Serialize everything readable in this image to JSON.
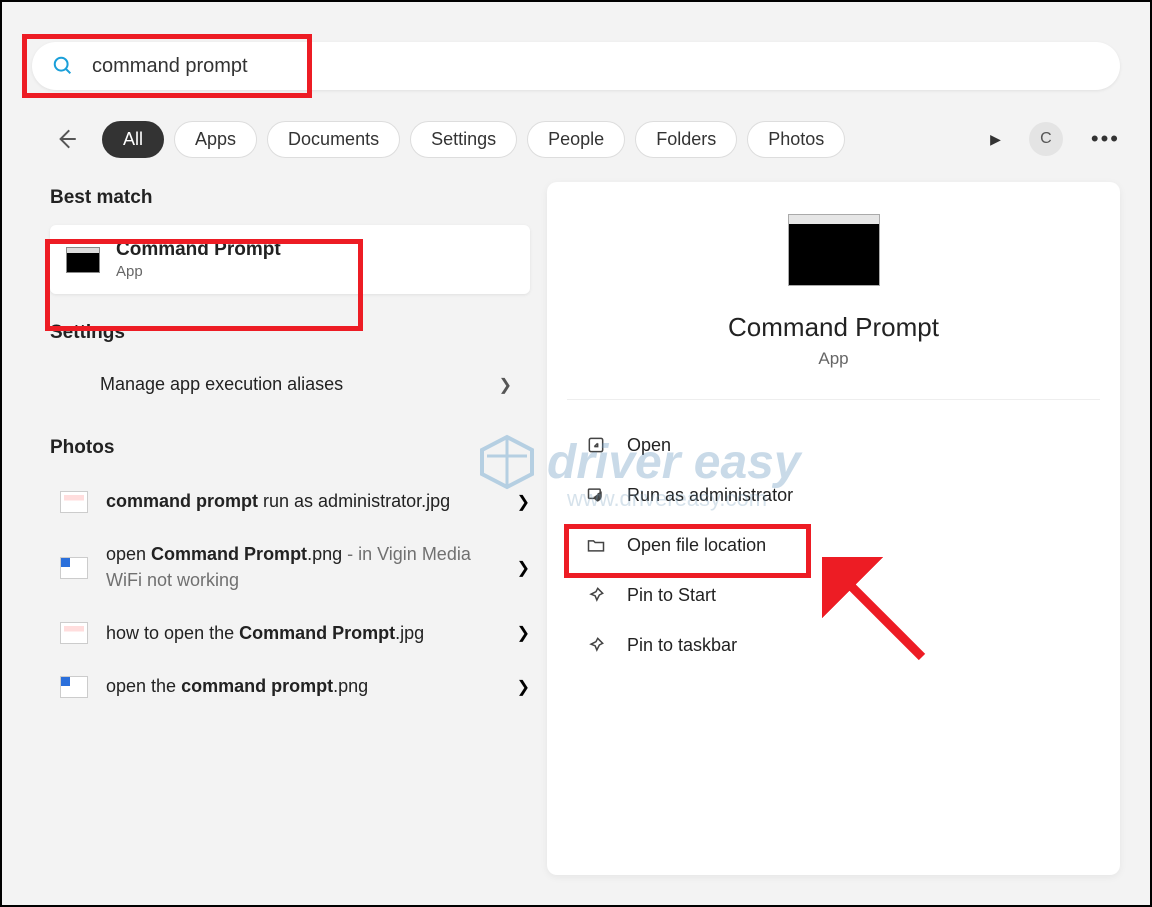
{
  "search": {
    "value": "command prompt"
  },
  "filters": [
    "All",
    "Apps",
    "Documents",
    "Settings",
    "People",
    "Folders",
    "Photos"
  ],
  "avatar_letter": "C",
  "left": {
    "best_match_label": "Best match",
    "best_match": {
      "title": "Command Prompt",
      "subtitle": "App"
    },
    "settings_label": "Settings",
    "settings_items": [
      "Manage app execution aliases"
    ],
    "photos_label": "Photos",
    "photos": [
      {
        "pre": "",
        "bold": "command prompt",
        "post": " run as administrator.jpg",
        "gray": ""
      },
      {
        "pre": "open ",
        "bold": "Command Prompt",
        "post": ".png",
        "gray": " - in Vigin Media WiFi not working"
      },
      {
        "pre": "how to open the ",
        "bold": "Command Prompt",
        "post": ".jpg",
        "gray": ""
      },
      {
        "pre": "open the ",
        "bold": "command prompt",
        "post": ".png",
        "gray": ""
      }
    ]
  },
  "right": {
    "title": "Command Prompt",
    "subtitle": "App",
    "actions": [
      "Open",
      "Run as administrator",
      "Open file location",
      "Pin to Start",
      "Pin to taskbar"
    ]
  },
  "watermark": {
    "brand": "driver easy",
    "url": "www.drivereasy.com"
  }
}
